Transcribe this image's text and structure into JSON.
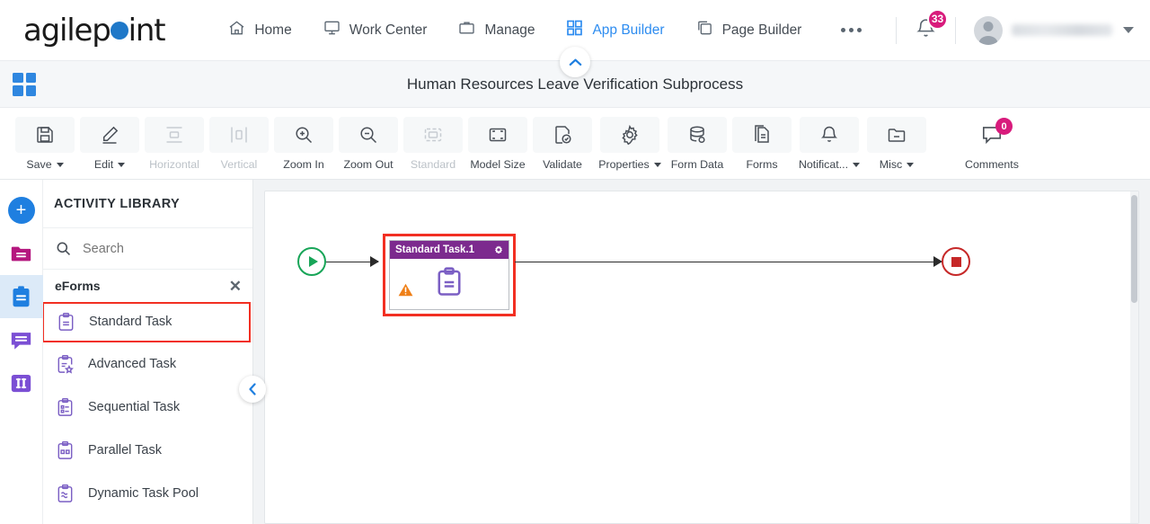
{
  "topnav": {
    "logo": {
      "part1": "agilep",
      "part2": "int",
      "dot": "logo-dot"
    },
    "items": [
      {
        "label": "Home",
        "icon": "home-icon",
        "active": false
      },
      {
        "label": "Work Center",
        "icon": "monitor-icon",
        "active": false
      },
      {
        "label": "Manage",
        "icon": "briefcase-icon",
        "active": false
      },
      {
        "label": "App Builder",
        "icon": "grid-icon",
        "active": true
      },
      {
        "label": "Page Builder",
        "icon": "copy-icon",
        "active": false
      }
    ],
    "more_icon": "ellipsis-icon",
    "notifications": {
      "icon": "bell-icon",
      "count": "33"
    },
    "user": {
      "avatar": "avatar-icon",
      "name": "",
      "caret": "chevron-down-icon"
    }
  },
  "titlebar": {
    "app_icon": "app-grid-icon",
    "title": "Human Resources Leave Verification Subprocess",
    "collapse_icon": "chevron-up-icon"
  },
  "toolbar": {
    "items": [
      {
        "label": "Save",
        "icon": "save-icon",
        "dropdown": true,
        "disabled": false,
        "badge": null
      },
      {
        "label": "Edit",
        "icon": "pencil-icon",
        "dropdown": true,
        "disabled": false,
        "badge": null
      },
      {
        "label": "Horizontal",
        "icon": "horizontal-icon",
        "dropdown": false,
        "disabled": true,
        "badge": null
      },
      {
        "label": "Vertical",
        "icon": "vertical-icon",
        "dropdown": false,
        "disabled": true,
        "badge": null
      },
      {
        "label": "Zoom In",
        "icon": "zoom-in-icon",
        "dropdown": false,
        "disabled": false,
        "badge": null
      },
      {
        "label": "Zoom Out",
        "icon": "zoom-out-icon",
        "dropdown": false,
        "disabled": false,
        "badge": null
      },
      {
        "label": "Standard",
        "icon": "standard-icon",
        "dropdown": false,
        "disabled": true,
        "badge": null
      },
      {
        "label": "Model Size",
        "icon": "model-size-icon",
        "dropdown": false,
        "disabled": false,
        "badge": null
      },
      {
        "label": "Validate",
        "icon": "validate-icon",
        "dropdown": false,
        "disabled": false,
        "badge": null
      },
      {
        "label": "Properties",
        "icon": "gear-icon",
        "dropdown": true,
        "disabled": false,
        "badge": null
      },
      {
        "label": "Form Data",
        "icon": "database-icon",
        "dropdown": false,
        "disabled": false,
        "badge": null
      },
      {
        "label": "Forms",
        "icon": "document-icon",
        "dropdown": false,
        "disabled": false,
        "badge": null
      },
      {
        "label": "Notificat...",
        "icon": "bell-icon",
        "dropdown": true,
        "disabled": false,
        "badge": null
      },
      {
        "label": "Misc",
        "icon": "folder-icon",
        "dropdown": true,
        "disabled": false,
        "badge": null
      },
      {
        "label": "Comments",
        "icon": "comment-icon",
        "dropdown": false,
        "disabled": false,
        "badge": "0"
      }
    ]
  },
  "rail": {
    "items": [
      {
        "name": "add-button",
        "icon": "plus-circle-icon",
        "color": "#1f7fe0",
        "selected": false
      },
      {
        "name": "folder-button",
        "icon": "folder-icon",
        "color": "#b5177f",
        "selected": false
      },
      {
        "name": "activities-button",
        "icon": "clipboard-icon",
        "color": "#1f7fe0",
        "selected": true
      },
      {
        "name": "comments-button",
        "icon": "speech-icon",
        "color": "#7b4fd4",
        "selected": false
      },
      {
        "name": "columns-button",
        "icon": "columns-icon",
        "color": "#7b4fd4",
        "selected": false
      }
    ]
  },
  "library": {
    "heading": "ACTIVITY LIBRARY",
    "search": {
      "placeholder": "Search",
      "value": "",
      "icon": "search-icon"
    },
    "group": {
      "label": "eForms",
      "close_icon": "close-icon"
    },
    "items": [
      {
        "label": "Standard Task",
        "icon": "standard-task-icon",
        "highlighted": true
      },
      {
        "label": "Advanced Task",
        "icon": "advanced-task-icon",
        "highlighted": false
      },
      {
        "label": "Sequential Task",
        "icon": "sequential-task-icon",
        "highlighted": false
      },
      {
        "label": "Parallel Task",
        "icon": "parallel-task-icon",
        "highlighted": false
      },
      {
        "label": "Dynamic Task Pool",
        "icon": "dynamic-task-pool-icon",
        "highlighted": false
      }
    ],
    "collapse_icon": "chevron-left-icon"
  },
  "canvas": {
    "start_node": {
      "name": "start-event",
      "icon": "play-icon",
      "color": "#18a558"
    },
    "end_node": {
      "name": "end-event",
      "icon": "stop-icon",
      "color": "#c62828"
    },
    "task": {
      "title": "Standard Task.1",
      "gear_icon": "gear-icon",
      "body_icon": "clipboard-icon",
      "warning_icon": "warning-icon",
      "header_color": "#7c2a8e",
      "highlight_color": "#f22f22"
    }
  }
}
